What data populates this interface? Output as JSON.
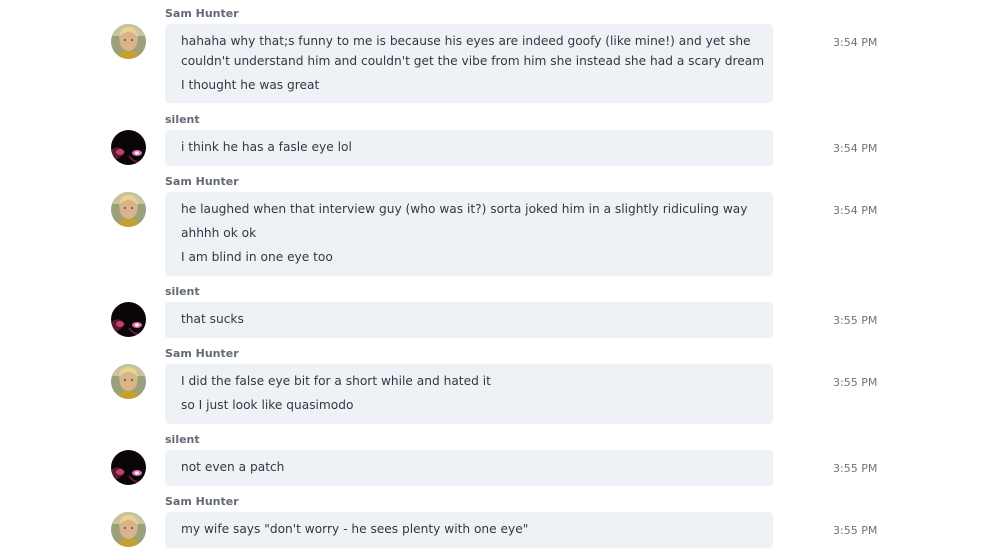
{
  "messages": [
    {
      "sender": "Sam Hunter",
      "avatar": "sam-avatar",
      "time": "3:54 PM",
      "lines": [
        "hahaha   why that;s funny to me is because his eyes are indeed goofy (like mine!) and yet she",
        "couldn't understand him and couldn't get the vibe from him she instead she had a scary dream",
        "I thought he was great"
      ]
    },
    {
      "sender": "silent",
      "avatar": "silent-avatar",
      "time": "3:54 PM",
      "lines": [
        "i think he has a fasle eye lol"
      ]
    },
    {
      "sender": "Sam Hunter",
      "avatar": "sam-avatar",
      "time": "3:54 PM",
      "lines": [
        "he laughed when that interview guy (who was it?) sorta joked him in a slightly ridiculing way",
        "ahhhh ok ok",
        "I am blind in one eye too"
      ]
    },
    {
      "sender": "silent",
      "avatar": "silent-avatar",
      "time": "3:55 PM",
      "lines": [
        "that sucks"
      ]
    },
    {
      "sender": "Sam Hunter",
      "avatar": "sam-avatar",
      "time": "3:55 PM",
      "lines": [
        "I did the false eye bit for a short while and hated it",
        "so I just look like quasimodo"
      ]
    },
    {
      "sender": "silent",
      "avatar": "silent-avatar",
      "time": "3:55 PM",
      "lines": [
        "not even a patch"
      ]
    },
    {
      "sender": "Sam Hunter",
      "avatar": "sam-avatar",
      "time": "3:55 PM",
      "lines": [
        "my wife says \"don't worry - he sees plenty with one eye\""
      ]
    }
  ]
}
